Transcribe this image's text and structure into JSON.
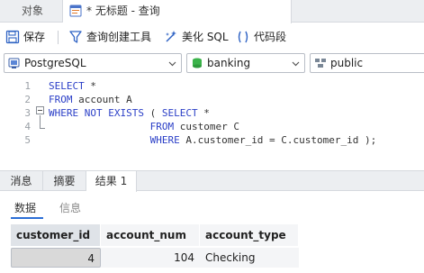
{
  "tabs": {
    "objects": "对象",
    "query": "* 无标题 - 查询"
  },
  "toolbar": {
    "save": "保存",
    "query_builder": "查询创建工具",
    "beautify_sql": "美化 SQL",
    "code_snippet": "代码段"
  },
  "connection": {
    "server": "PostgreSQL",
    "database": "banking",
    "schema": "public"
  },
  "editor": {
    "lines": [
      {
        "num": "1",
        "kw1": "SELECT",
        "rest": " *"
      },
      {
        "num": "2",
        "kw1": "FROM",
        "rest": " account A"
      },
      {
        "num": "3",
        "kw1": "WHERE NOT EXISTS",
        "rest": " ( ",
        "kw2": "SELECT",
        "rest2": " *"
      },
      {
        "num": "4",
        "pad": "                 ",
        "kw1": "FROM",
        "rest": " customer C"
      },
      {
        "num": "5",
        "pad": "                 ",
        "kw1": "WHERE",
        "rest": " A.customer_id = C.customer_id );"
      }
    ]
  },
  "result_tabs": [
    "消息",
    "摘要",
    "结果 1"
  ],
  "sub_tabs": [
    "数据",
    "信息"
  ],
  "grid": {
    "columns": [
      "customer_id",
      "account_num",
      "account_type"
    ],
    "rows": [
      [
        "4",
        "104",
        "Checking"
      ]
    ]
  }
}
